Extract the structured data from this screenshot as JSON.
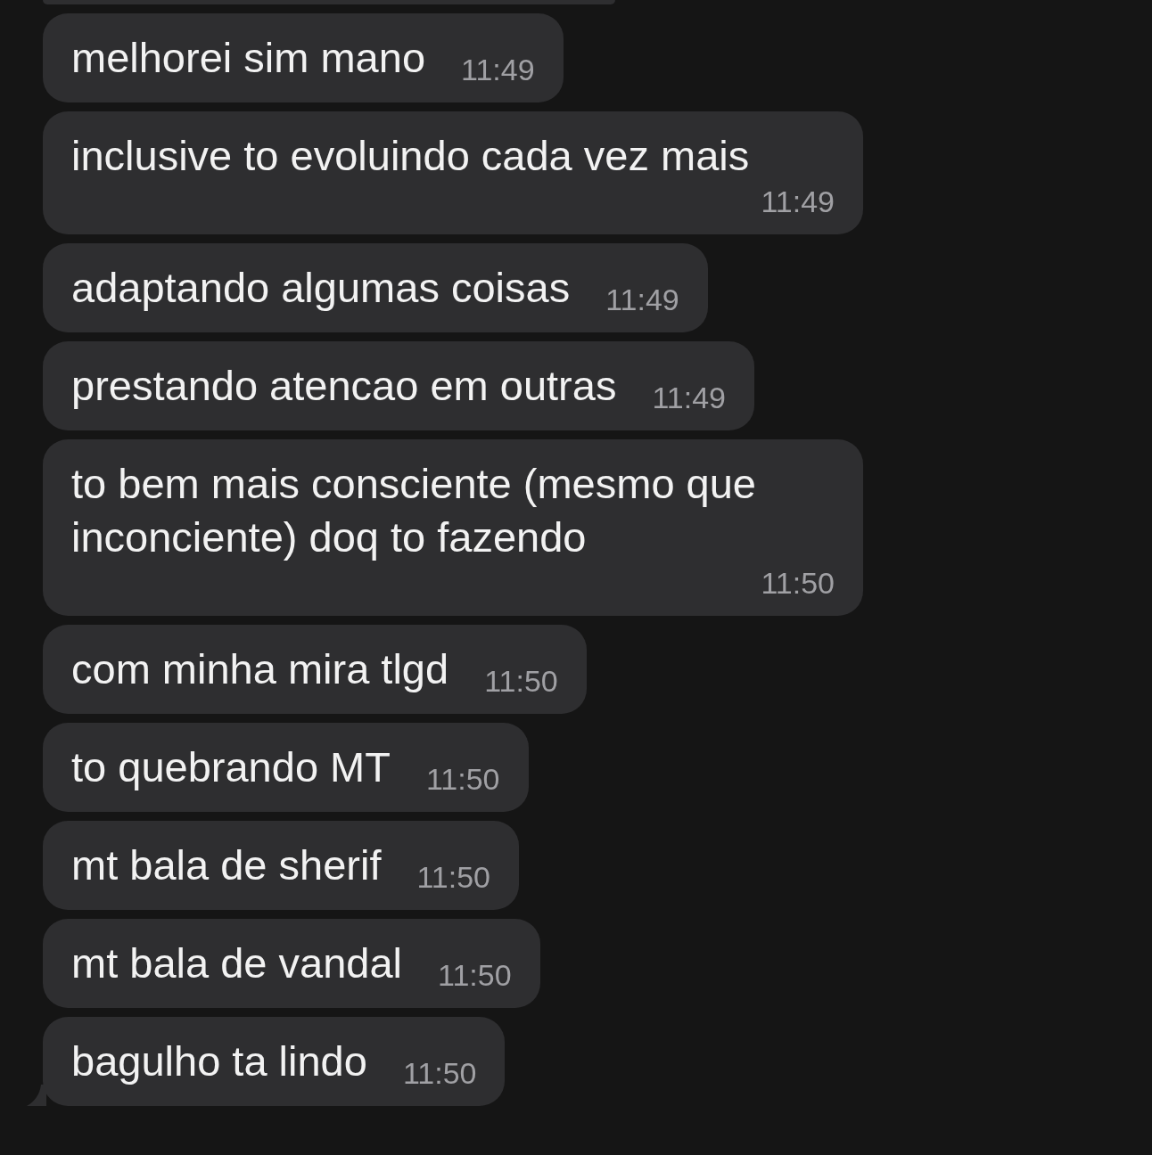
{
  "messages": [
    {
      "text": "melhorei sim mano",
      "time": "11:49",
      "tail": false
    },
    {
      "text": "inclusive to evoluindo cada vez mais",
      "time": "11:49",
      "tail": false
    },
    {
      "text": "adaptando algumas coisas",
      "time": "11:49",
      "tail": false
    },
    {
      "text": "prestando atencao em outras",
      "time": "11:49",
      "tail": false
    },
    {
      "text": "to bem mais consciente (mesmo que inconciente) doq to fazendo",
      "time": "11:50",
      "tail": false
    },
    {
      "text": "com minha mira tlgd",
      "time": "11:50",
      "tail": false
    },
    {
      "text": "to quebrando MT",
      "time": "11:50",
      "tail": false
    },
    {
      "text": "mt bala de sherif",
      "time": "11:50",
      "tail": false
    },
    {
      "text": "mt bala de vandal",
      "time": "11:50",
      "tail": false
    },
    {
      "text": "bagulho ta lindo",
      "time": "11:50",
      "tail": true
    }
  ]
}
